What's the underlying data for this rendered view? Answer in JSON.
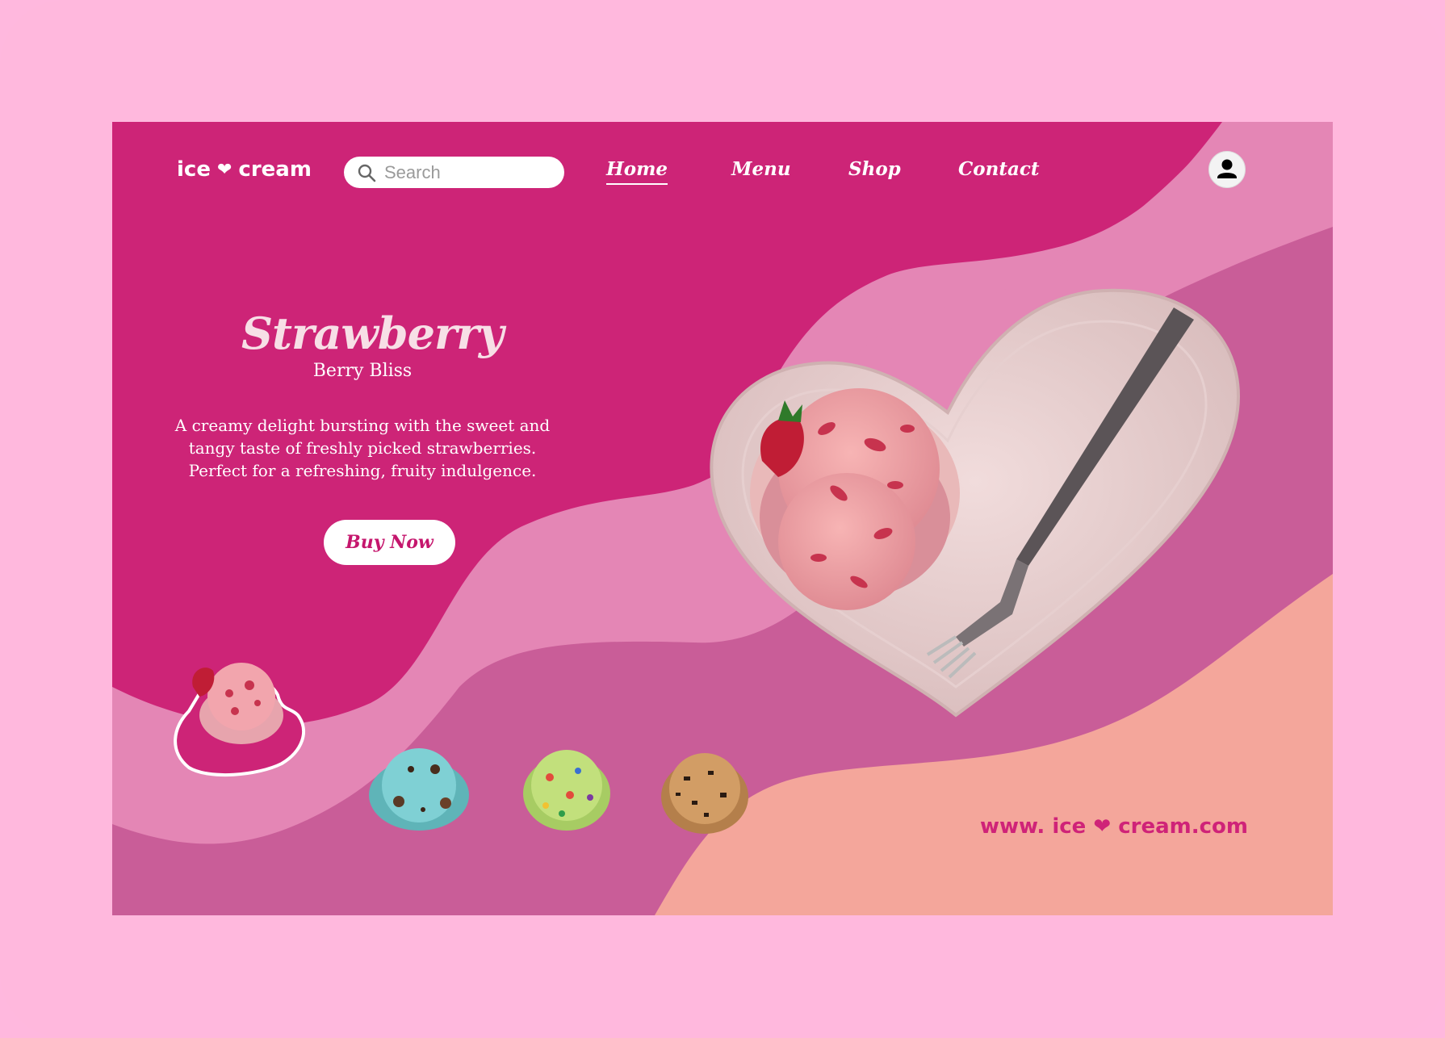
{
  "header": {
    "logo": {
      "word1": "ice",
      "heart": "❤",
      "word2": "cream"
    },
    "search": {
      "placeholder": "Search"
    },
    "nav": [
      {
        "label": "Home",
        "active": true
      },
      {
        "label": "Menu",
        "active": false
      },
      {
        "label": "Shop",
        "active": false
      },
      {
        "label": "Contact",
        "active": false
      }
    ],
    "account_icon": "user-icon"
  },
  "hero": {
    "title": "Strawberry",
    "subtitle": "Berry Bliss",
    "description": "A creamy delight bursting with the sweet and tangy taste of freshly picked strawberries. Perfect for a refreshing, fruity indulgence.",
    "cta_label": "Buy Now",
    "image": "strawberry-ice-cream-on-heart-plate"
  },
  "flavors": [
    {
      "name": "strawberry",
      "selected": true
    },
    {
      "name": "mint-chocolate",
      "selected": false
    },
    {
      "name": "pistachio-candy",
      "selected": false
    },
    {
      "name": "coffee-chip",
      "selected": false
    }
  ],
  "footer": {
    "url_prefix": "www. ice",
    "url_heart": "❤",
    "url_suffix": "cream.com"
  },
  "colors": {
    "page_bg": "#ffb8de",
    "hero_magenta": "#cd2477",
    "wave_light": "#e486b5",
    "wave_mid": "#c95d98",
    "wave_peach": "#f4a69b",
    "accent_text": "#c5166d"
  }
}
